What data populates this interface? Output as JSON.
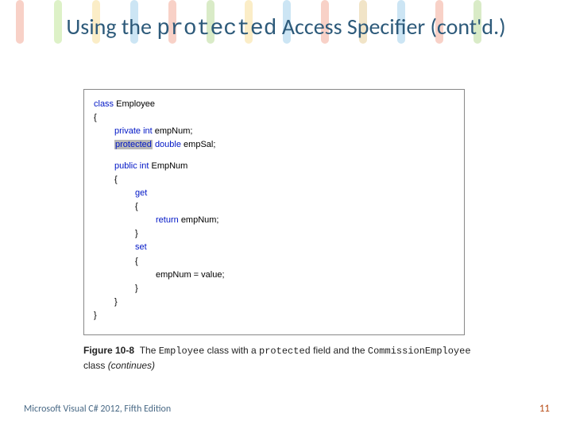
{
  "title": {
    "pre": "Using the ",
    "mono": "protected",
    "post": " Access Specifier (cont'd.)"
  },
  "code": {
    "l1_kw": "class",
    "l1_id": "Employee",
    "l2": "{",
    "l3_kw": "private int",
    "l3_id": "empNum;",
    "l4_hl": "protected",
    "l4_kw": "double",
    "l4_id": "empSal;",
    "l5_kw": "public int",
    "l5_id": "EmpNum",
    "l6": "{",
    "l7_kw": "get",
    "l8": "{",
    "l9_kw": "return",
    "l9_id": "empNum;",
    "l10": "}",
    "l11_kw": "set",
    "l12": "{",
    "l13": "empNum = value;",
    "l14": "}",
    "l15": "}",
    "l16": "}"
  },
  "caption": {
    "fig": "Figure 10-8",
    "t1": "The ",
    "m1": "Employee",
    "t2": " class with a ",
    "m2": "protected",
    "t3": " field and the ",
    "m3": "CommissionEmployee",
    "t4": " class ",
    "cont": "(continues)"
  },
  "footer": "Microsoft Visual C# 2012, Fifth Edition",
  "page": "11",
  "streaks": [
    "#e85c3b",
    "#89d03a",
    "#f2c238",
    "#4aa6d8",
    "#e85c3b",
    "#7bb93a",
    "#f2c238",
    "#4aa6d8",
    "#e85c3b",
    "#cfa038",
    "#4aa6d8",
    "#e85c3b",
    "#7bb93a"
  ]
}
